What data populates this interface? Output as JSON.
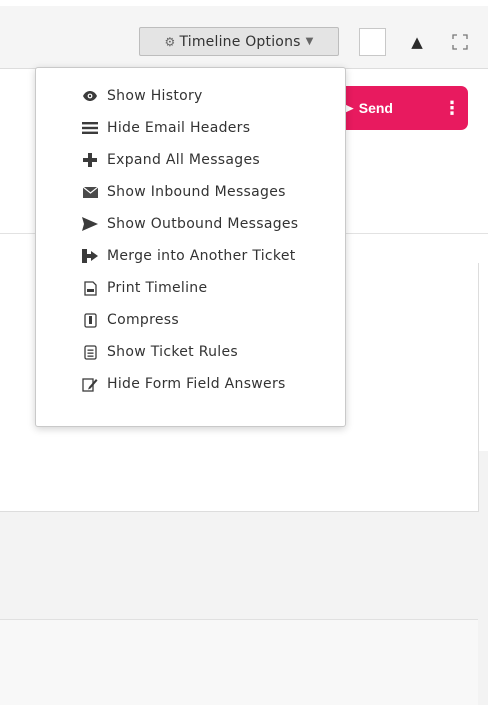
{
  "toolbar": {
    "timeline_options_label": "Timeline Options",
    "gear_icon": "gear-icon",
    "caret_icon": "caret-down-icon",
    "collapse_icon": "triangle-up-icon",
    "expand_icon": "expand-icon"
  },
  "composer": {
    "send_label": "Send",
    "send_icon": "paper-plane-icon",
    "more_icon": "vertical-ellipsis-icon",
    "accent": "#e81a5f"
  },
  "menu": {
    "items": [
      {
        "label": "Show History",
        "icon": "eye-icon"
      },
      {
        "label": "Hide Email Headers",
        "icon": "bars-icon"
      },
      {
        "label": "Expand All Messages",
        "icon": "plus-icon"
      },
      {
        "label": "Show Inbound Messages",
        "icon": "envelope-icon"
      },
      {
        "label": "Show Outbound Messages",
        "icon": "send-arrow-icon"
      },
      {
        "label": "Merge into Another Ticket",
        "icon": "merge-icon"
      },
      {
        "label": "Print Timeline",
        "icon": "print-icon"
      },
      {
        "label": "Compress",
        "icon": "compress-icon"
      },
      {
        "label": "Show Ticket Rules",
        "icon": "list-icon"
      },
      {
        "label": "Hide Form Field Answers",
        "icon": "edit-form-icon"
      }
    ]
  }
}
